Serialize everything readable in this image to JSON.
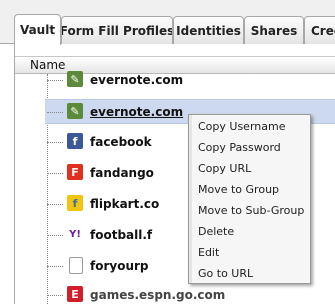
{
  "tabs": [
    {
      "label": "Vault"
    },
    {
      "label": "Form Fill Profiles"
    },
    {
      "label": "Identities"
    },
    {
      "label": "Shares"
    },
    {
      "label": "Cred"
    }
  ],
  "list": {
    "column_header": "Name",
    "rows": [
      {
        "name": "evernote.com",
        "icon": "evernote-icon",
        "color": "#5a8a3a"
      },
      {
        "name": "evernote.com",
        "icon": "evernote-icon",
        "color": "#5a8a3a"
      },
      {
        "name": "facebook",
        "icon": "facebook-icon",
        "color": "#3b5998"
      },
      {
        "name": "fandango",
        "icon": "fandango-icon",
        "color": "#e0301e"
      },
      {
        "name": "flipkart.co",
        "icon": "flipkart-icon",
        "color": "#f1c40f"
      },
      {
        "name": "football.f",
        "icon": "yahoo-icon",
        "color": "#6b1e9c"
      },
      {
        "name": "foryourp",
        "icon": "page-icon",
        "color": "#ffffff"
      },
      {
        "name": "games.espn.go.com",
        "icon": "espn-icon",
        "color": "#d11f2a"
      }
    ]
  },
  "context_menu": {
    "items": [
      "Copy Username",
      "Copy Password",
      "Copy URL",
      "Move to Group",
      "Move to Sub-Group",
      "Delete",
      "Edit",
      "Go to URL"
    ]
  }
}
